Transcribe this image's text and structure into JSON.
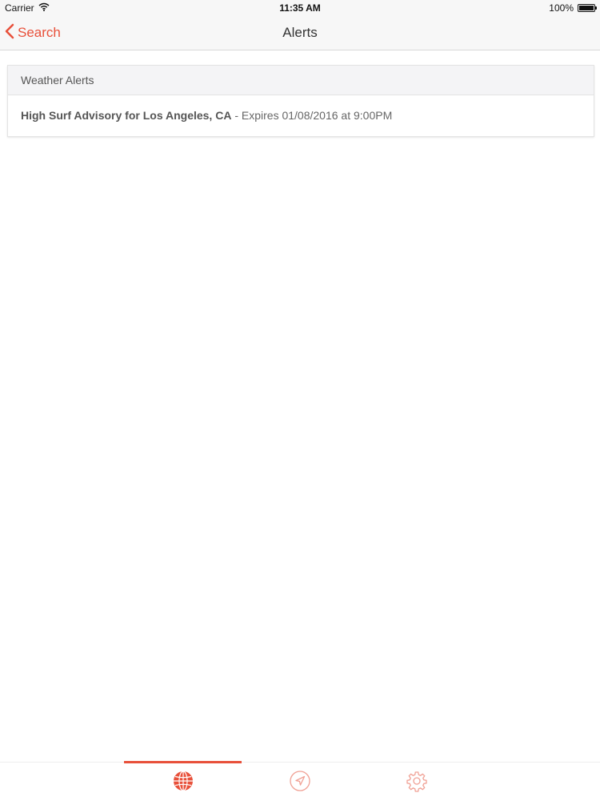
{
  "status_bar": {
    "carrier": "Carrier",
    "time": "11:35 AM",
    "battery_percent": "100%",
    "battery_level": 1.0
  },
  "nav": {
    "back_label": "Search",
    "title": "Alerts"
  },
  "alerts_card": {
    "header": "Weather Alerts",
    "items": [
      {
        "title": "High Surf Advisory for Los Angeles, CA",
        "separator": " - ",
        "expires": "Expires 01/08/2016 at 9:00PM"
      }
    ]
  },
  "tab_bar": {
    "tabs": [
      {
        "icon": "globe-icon",
        "active": true
      },
      {
        "icon": "location-arrow-icon",
        "active": false
      },
      {
        "icon": "gear-icon",
        "active": false
      }
    ]
  },
  "colors": {
    "accent": "#e8503a",
    "nav_background": "#f7f7f7",
    "card_header_background": "#f4f4f6"
  }
}
